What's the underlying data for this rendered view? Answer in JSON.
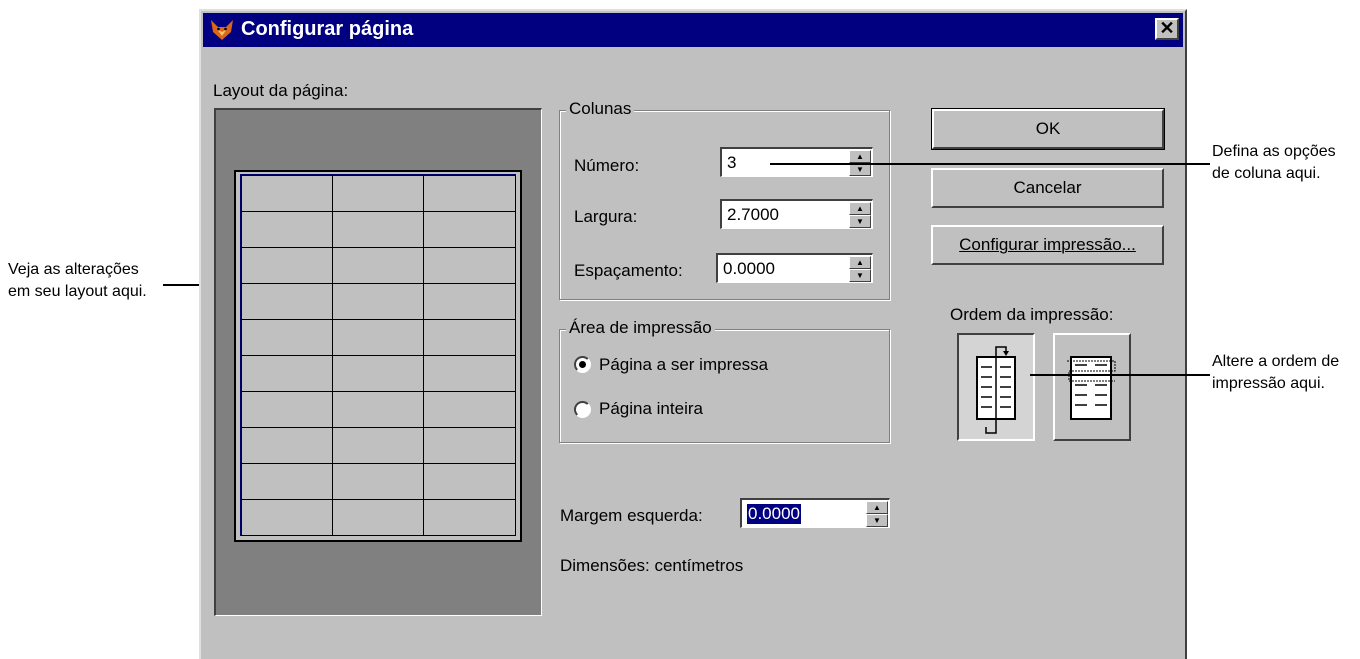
{
  "window": {
    "title": "Configurar página",
    "close_glyph": "✕"
  },
  "layout": {
    "label": "Layout da página:"
  },
  "colunas": {
    "legend": "Colunas",
    "numero_label": "Número:",
    "numero_value": "3",
    "largura_label": "Largura:",
    "largura_value": "2.7000",
    "espacamento_label": "Espaçamento:",
    "espacamento_value": "0.0000"
  },
  "area": {
    "legend": "Área de impressão",
    "option1": "Página a ser impressa",
    "option2": "Página inteira",
    "selected": "option1"
  },
  "margem": {
    "label": "Margem esquerda:",
    "value": "0.0000"
  },
  "dimensoes": "Dimensões: centímetros",
  "buttons": {
    "ok": "OK",
    "cancel": "Cancelar",
    "print_setup": "Configurar impressão..."
  },
  "order": {
    "label": "Ordem da impressão:",
    "options": [
      "top-to-bottom-icon",
      "left-to-right-icon"
    ],
    "selected": 0
  },
  "callouts": {
    "left": [
      "Veja as alterações",
      "em seu layout aqui."
    ],
    "right_top": [
      "Defina as opções",
      "de coluna aqui."
    ],
    "right_mid": [
      "Altere a ordem de",
      "impressão aqui."
    ]
  },
  "colors": {
    "title_bar": "#000080",
    "dialog_bg": "#c0c0c0",
    "preview_bg": "#808080",
    "selection": "#000080"
  }
}
